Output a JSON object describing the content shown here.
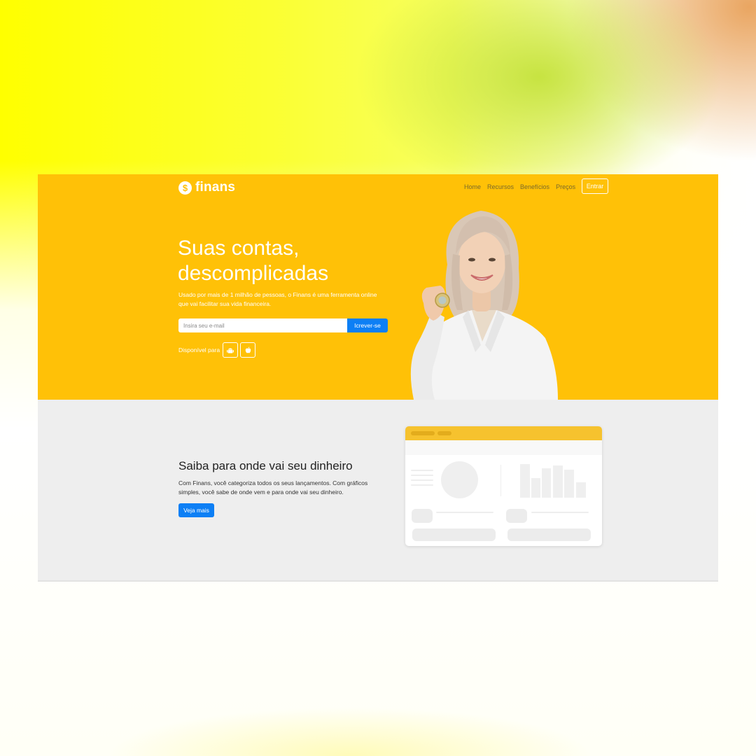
{
  "brand": {
    "name": "finans",
    "icon": "dollar-icon",
    "accent": "#ffc107",
    "button_blue": "#0d7ff5"
  },
  "nav": {
    "links": [
      "Home",
      "Recursos",
      "Benefícios",
      "Preços"
    ],
    "login_label": "Entrar"
  },
  "hero": {
    "title_line1": "Suas contas,",
    "title_line2": "descomplicadas",
    "description": "Usado por mais de 1 milhão de pessoas, o Finans é uma ferramenta online que vai facilitar sua vida financeira.",
    "email_placeholder": "Insira seu e-mail",
    "subscribe_label": "Icrever-se",
    "available_label": "Disponível para",
    "stores": [
      "android-icon",
      "apple-icon"
    ]
  },
  "feature": {
    "title": "Saiba para onde vai seu dinheiro",
    "description": "Com Finans, você categoriza todos os seus lançamentos. Com gráficos simples, você sabe de onde vem e para onde vai seu dinheiro.",
    "button_label": "Veja mais"
  }
}
